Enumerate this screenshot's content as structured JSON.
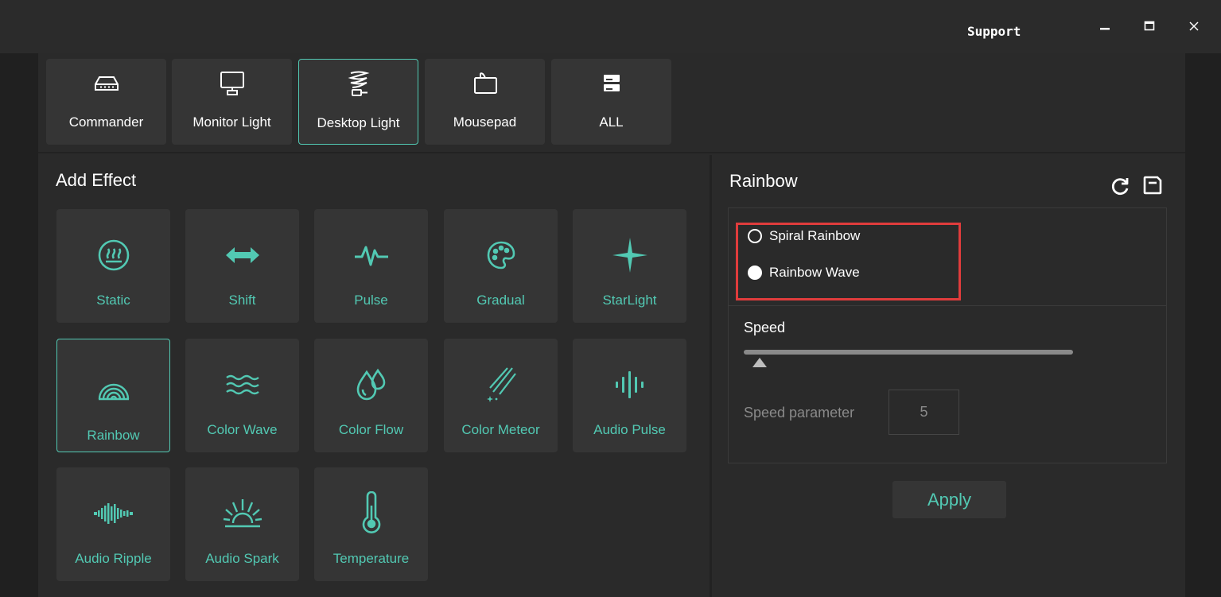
{
  "window": {
    "support_label": "Support",
    "controls": [
      "minimize-icon",
      "maximize-icon",
      "close-icon"
    ]
  },
  "devices": [
    {
      "label": "Commander",
      "icon": "commander-icon"
    },
    {
      "label": "Monitor Light",
      "icon": "monitor-icon"
    },
    {
      "label": "Desktop Light",
      "icon": "desktop-light-icon",
      "selected": true
    },
    {
      "label": "Mousepad",
      "icon": "mousepad-icon"
    },
    {
      "label": "ALL",
      "icon": "all-devices-icon"
    }
  ],
  "effects_panel": {
    "title": "Add Effect",
    "effects": [
      {
        "label": "Static",
        "icon": "static-icon"
      },
      {
        "label": "Shift",
        "icon": "shift-arrows-icon"
      },
      {
        "label": "Pulse",
        "icon": "pulse-icon"
      },
      {
        "label": "Gradual",
        "icon": "palette-icon"
      },
      {
        "label": "StarLight",
        "icon": "star-icon"
      },
      {
        "label": "Rainbow",
        "icon": "rainbow-icon",
        "selected": true
      },
      {
        "label": "Color Wave",
        "icon": "wave-icon"
      },
      {
        "label": "Color Flow",
        "icon": "drops-icon"
      },
      {
        "label": "Color Meteor",
        "icon": "meteor-icon"
      },
      {
        "label": "Audio Pulse",
        "icon": "audio-bars-icon"
      },
      {
        "label": "Audio Ripple",
        "icon": "audio-ripple-icon"
      },
      {
        "label": "Audio Spark",
        "icon": "sunburst-icon"
      },
      {
        "label": "Temperature",
        "icon": "thermometer-icon"
      }
    ]
  },
  "effect_settings": {
    "title": "Rainbow",
    "icons": [
      "reset-icon",
      "save-icon"
    ],
    "modes": [
      {
        "label": "Spiral Rainbow",
        "selected": false
      },
      {
        "label": "Rainbow Wave",
        "selected": true
      }
    ],
    "speed_label": "Speed",
    "speed_parameter_label": "Speed parameter",
    "speed_value": "5",
    "apply_label": "Apply"
  },
  "colors": {
    "accent": "#52c9b3",
    "background": "#2a2a2a",
    "tile": "#353535",
    "highlight_box": "#e03c3c"
  }
}
